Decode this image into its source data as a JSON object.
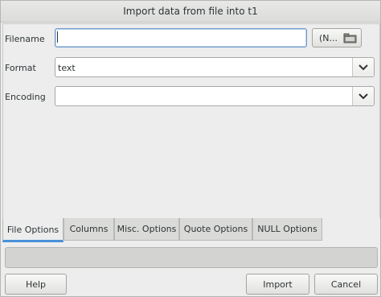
{
  "window": {
    "title": "Import data from file into t1"
  },
  "form": {
    "filename_label": "Filename",
    "filename_value": "",
    "filename_button_label": "(N...",
    "format_label": "Format",
    "format_value": "text",
    "encoding_label": "Encoding",
    "encoding_value": ""
  },
  "tabs": [
    {
      "label": "File Options",
      "active": true
    },
    {
      "label": "Columns",
      "active": false
    },
    {
      "label": "Misc. Options",
      "active": false
    },
    {
      "label": "Quote Options",
      "active": false
    },
    {
      "label": "NULL Options",
      "active": false
    }
  ],
  "progress": {
    "fraction": 0
  },
  "buttons": {
    "help": "Help",
    "import": "Import",
    "cancel": "Cancel"
  },
  "icons": {
    "file_chooser": "folder-icon",
    "dropdown": "chevron-down-icon"
  },
  "colors": {
    "accent": "#4a90d9",
    "background": "#ededed"
  }
}
